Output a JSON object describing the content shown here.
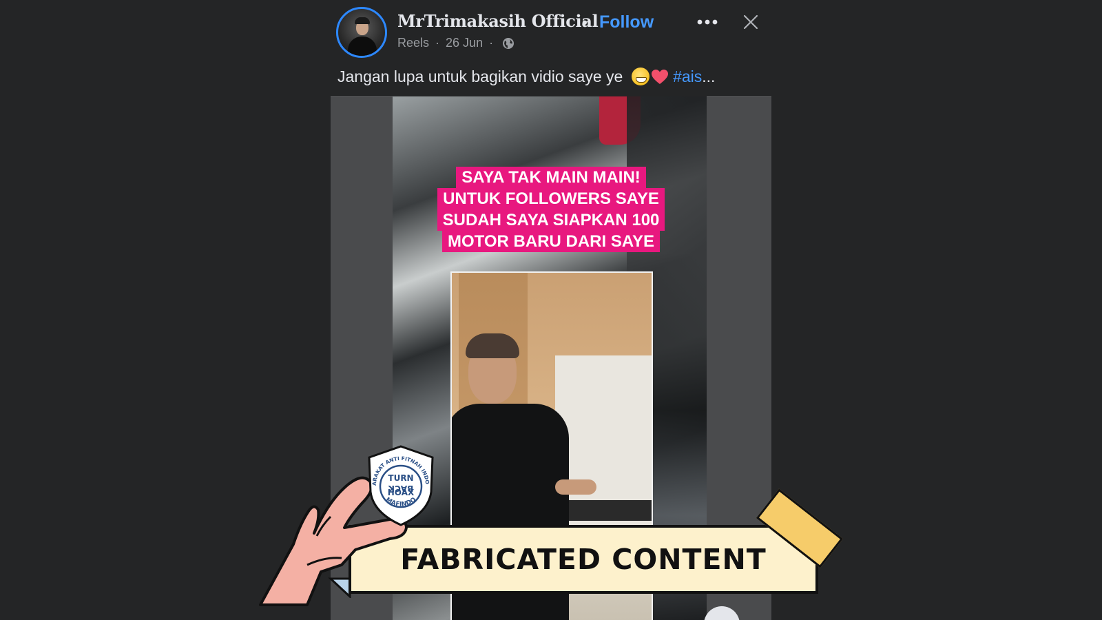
{
  "post": {
    "author_name": "MrTrimakasih Official",
    "follow_label": "Follow",
    "separator": "•",
    "meta": {
      "source": "Reels",
      "date": "26 Jun",
      "dot": "·"
    },
    "caption_text": "Jangan lupa untuk bagikan vidio saye ye ",
    "caption_hashtag": "#ais",
    "caption_ellipsis": "..."
  },
  "video": {
    "overlay_lines": [
      "SAYA TAK MAIN MAIN!",
      "UNTUK FOLLOWERS SAYE",
      "SUDAH SAYA SIAPKAN 100",
      "MOTOR BARU DARI SAYE"
    ]
  },
  "badge": {
    "org_ring_text": "MASYARAKAT ANTI FITNAH INDONESIA",
    "org_name": "MAFINDO",
    "logo_words": [
      "TURN",
      "BACK",
      "HOAX"
    ],
    "label": "FABRICATED CONTENT"
  },
  "icons": {
    "more": "more-horizontal-icon",
    "close": "close-icon",
    "globe": "globe-icon",
    "grin_emoji": "grinning-face-emoji",
    "heart_emoji": "red-heart-emoji"
  },
  "colors": {
    "background": "#242526",
    "link": "#4599ff",
    "avatar_ring": "#2d88ff",
    "overlay_pink": "#e8187f",
    "banner_fill": "#fdf1cc",
    "tape": "#f6cc6a",
    "hand": "#f4b0a4"
  }
}
